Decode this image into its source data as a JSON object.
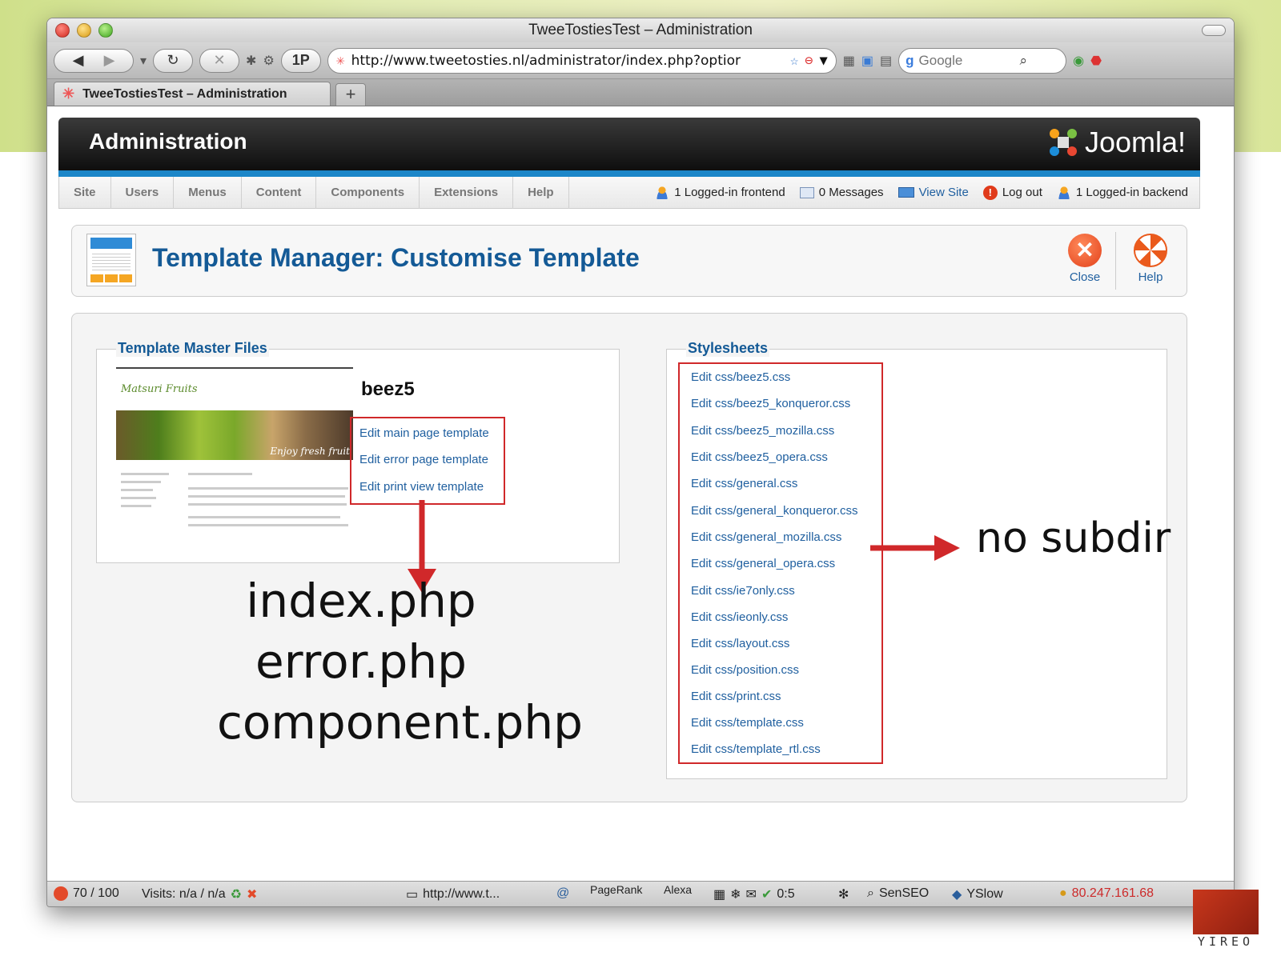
{
  "browser": {
    "window_title": "TweeTostiesTest – Administration",
    "url": "http://www.tweetosties.nl/administrator/index.php?optior",
    "search_placeholder": "Google",
    "onep_label": "1P",
    "tab_title": "TweeTostiesTest – Administration",
    "new_tab": "+"
  },
  "header": {
    "title": "Administration",
    "logo_text": "Joomla!"
  },
  "menu": {
    "items": [
      "Site",
      "Users",
      "Menus",
      "Content",
      "Components",
      "Extensions",
      "Help"
    ],
    "status": {
      "frontend": "1 Logged-in frontend",
      "messages": "0 Messages",
      "view_site": "View Site",
      "logout": "Log out",
      "backend": "1 Logged-in backend"
    }
  },
  "toolbar": {
    "page_title": "Template Manager: Customise Template",
    "close_label": "Close",
    "help_label": "Help"
  },
  "master_files": {
    "legend": "Template Master Files",
    "template_name": "beez5",
    "links": [
      "Edit main page template",
      "Edit error page template",
      "Edit print view template"
    ]
  },
  "stylesheets": {
    "legend": "Stylesheets",
    "links": [
      "Edit css/beez5.css",
      "Edit css/beez5_konqueror.css",
      "Edit css/beez5_mozilla.css",
      "Edit css/beez5_opera.css",
      "Edit css/general.css",
      "Edit css/general_konqueror.css",
      "Edit css/general_mozilla.css",
      "Edit css/general_opera.css",
      "Edit css/ie7only.css",
      "Edit css/ieonly.css",
      "Edit css/layout.css",
      "Edit css/position.css",
      "Edit css/print.css",
      "Edit css/template.css",
      "Edit css/template_rtl.css"
    ]
  },
  "annotations": {
    "files": [
      "index.php",
      "error.php",
      "component.php"
    ],
    "no_subdir": "no subdir",
    "arrow_color": "#d0282a"
  },
  "statusbar": {
    "score": "70 / 100",
    "visits": "Visits: n/a / n/a",
    "url": "http://www.t...",
    "pagerank": "PageRank",
    "alexa": "Alexa",
    "ratio": "0:5",
    "senseo": "SenSEO",
    "yslow": "YSlow",
    "ip": "80.247.161.68"
  },
  "brand": {
    "name": "YIREO"
  },
  "colors": {
    "accent": "#1b86c8",
    "title_blue": "#145a96",
    "highlight": "#d0282a"
  }
}
